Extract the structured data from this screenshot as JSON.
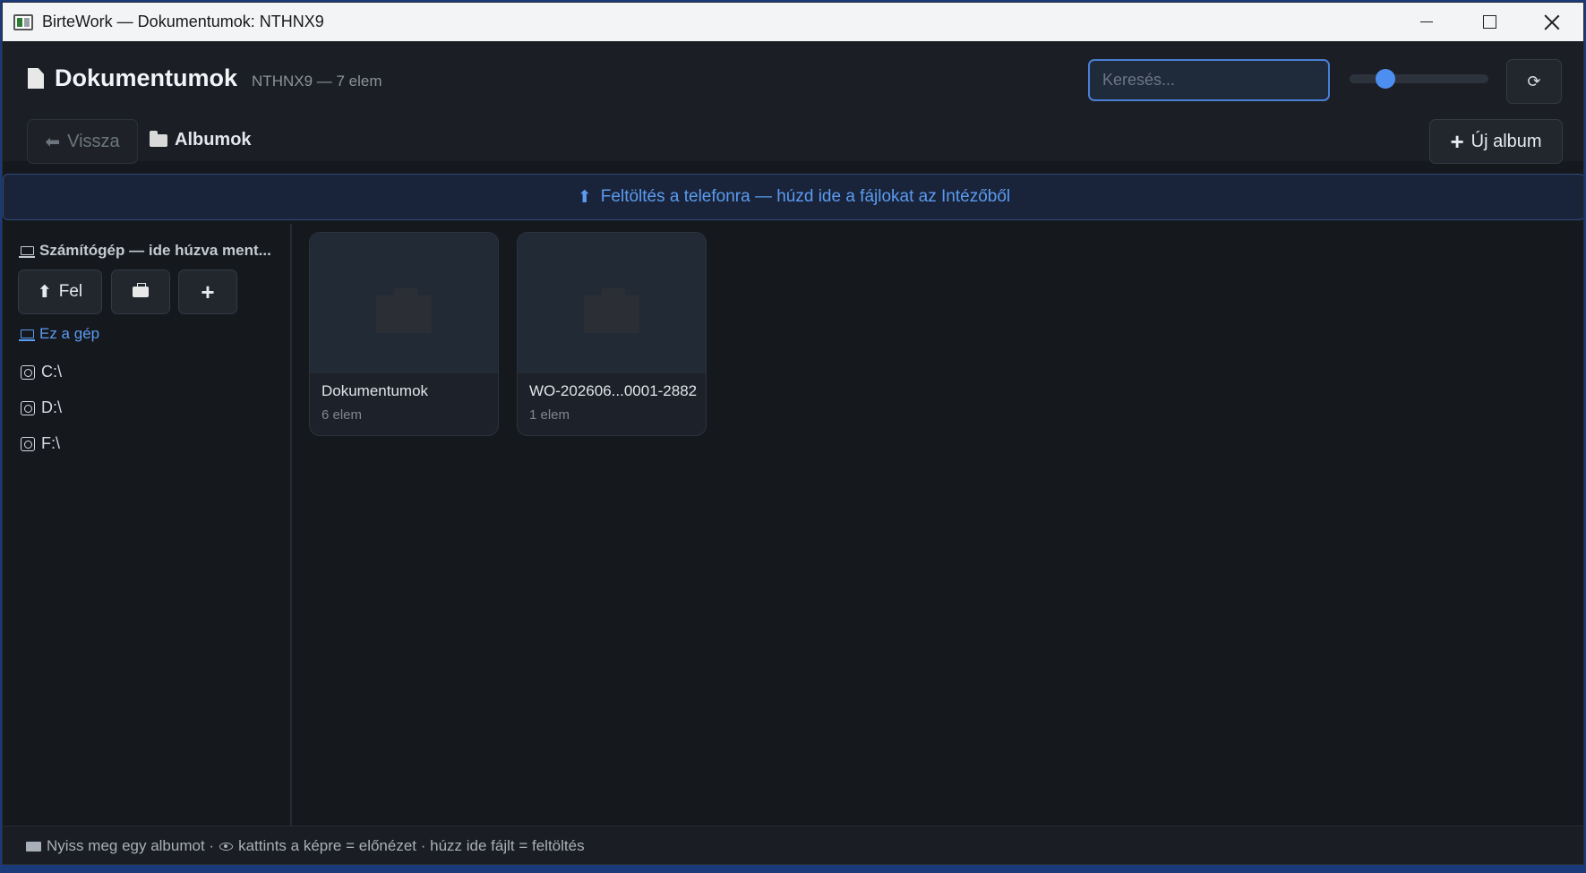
{
  "window": {
    "title": "BirteWork — Dokumentumok: NTHNX9"
  },
  "header": {
    "title": "Dokumentumok",
    "subtitle": "NTHNX9 — 7 elem",
    "search_placeholder": "Keresés...",
    "search_value": "",
    "zoom_slider_fraction": 0.26,
    "refresh_glyph": "⟳",
    "back_label": "Vissza",
    "back_glyph": "⬅",
    "breadcrumb_current": "Albumok",
    "new_album_label": "Új album",
    "new_album_glyph": "+"
  },
  "upload_banner": {
    "glyph": "⬆",
    "text": "Feltöltés a telefonra — húzd ide a fájlokat az Intézőből"
  },
  "sidebar": {
    "heading": "Számítógép — ide húzva ment...",
    "up_label": "Fel",
    "up_glyph": "⬆",
    "new_glyph": "+",
    "this_pc_label": "Ez a gép",
    "drives": [
      {
        "label": "C:\\"
      },
      {
        "label": "D:\\"
      },
      {
        "label": "F:\\"
      }
    ]
  },
  "albums": [
    {
      "name": "Dokumentumok",
      "count": "6 elem"
    },
    {
      "name": "WO-202606...0001-2882",
      "count": "1 elem"
    }
  ],
  "statusbar": {
    "part1": "Nyiss meg egy albumot ·",
    "part2": "kattints a képre = előnézet · húzz ide fájlt = feltöltés"
  },
  "colors": {
    "accent": "#4d8ff0",
    "link": "#5b9bf0",
    "background": "#15181d"
  },
  "icons": {
    "document": "document-icon",
    "folder": "folder-icon",
    "laptop": "laptop-icon",
    "disk": "disk-icon",
    "eye": "eye-icon"
  }
}
